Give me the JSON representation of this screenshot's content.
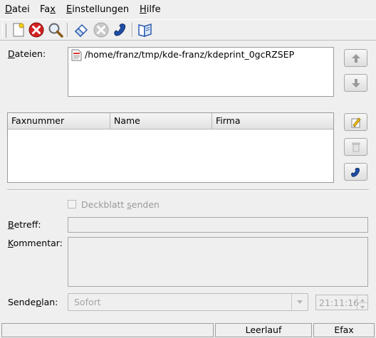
{
  "menu": {
    "items": [
      {
        "label": "Datei",
        "u": "D",
        "rest": "atei"
      },
      {
        "label": "Fax",
        "pre": "Fa",
        "u": "x",
        "rest": ""
      },
      {
        "label": "Einstellungen",
        "u": "E",
        "rest": "instellungen"
      },
      {
        "label": "Hilfe",
        "u": "H",
        "rest": "ilfe"
      }
    ]
  },
  "toolbar": {
    "icons": [
      "new-file-icon",
      "cancel-icon",
      "preview-icon",
      "clear-icon",
      "stop-icon",
      "send-fax-icon",
      "address-book-icon"
    ]
  },
  "files": {
    "label_u": "D",
    "label_rest": "ateien:",
    "items": [
      "/home/franz/tmp/kde-franz/kdeprint_0gcRZSEP"
    ]
  },
  "recipients": {
    "columns": [
      "Faxnummer",
      "Name",
      "Firma"
    ],
    "rows": []
  },
  "cover": {
    "label_pre": "Deckblatt ",
    "label_u": "s",
    "label_rest": "enden",
    "checked": false
  },
  "subject": {
    "label_u": "B",
    "label_rest": "etreff:",
    "value": ""
  },
  "comment": {
    "label_u": "K",
    "label_rest": "ommentar:",
    "value": ""
  },
  "schedule": {
    "label_pre": "Sende",
    "label_u": "p",
    "label_rest": "lan:",
    "value": "Sofort",
    "time": "21:11:16"
  },
  "status": {
    "message": "",
    "state": "Leerlauf",
    "app": "Efax"
  },
  "colors": {
    "accent_blue": "#1f4fa8",
    "cancel_red": "#d32222",
    "note_yellow": "#f0c020"
  }
}
